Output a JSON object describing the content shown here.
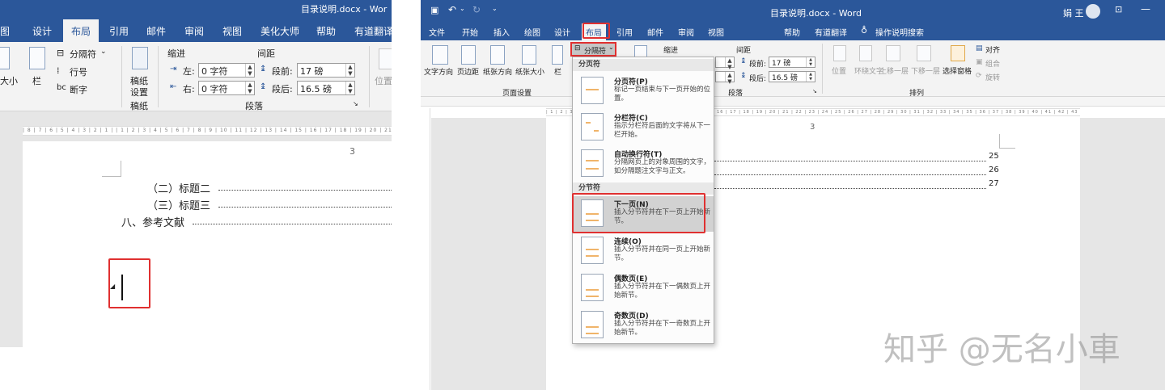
{
  "left": {
    "title": "目录说明.docx - Wor",
    "tabs": [
      "图",
      "设计",
      "布局",
      "引用",
      "邮件",
      "审阅",
      "视图",
      "美化大师",
      "帮助",
      "有道翻译"
    ],
    "ribbon": {
      "size_label": "大小",
      "columns_label": "栏",
      "breaks_label": "分隔符",
      "line_numbers_label": "行号",
      "hyphenation_label": "断字",
      "draft_paper_line1": "稿纸",
      "draft_paper_line2": "设置",
      "draft_paper_group": "稿纸",
      "indent_header": "缩进",
      "spacing_header": "间距",
      "indent_left_label": "左:",
      "indent_left_value": "0 字符",
      "indent_right_label": "右:",
      "indent_right_value": "0 字符",
      "spacing_before_label": "段前:",
      "spacing_before_value": "17 磅",
      "spacing_after_label": "段后:",
      "spacing_after_value": "16.5 磅",
      "paragraph_group": "段落",
      "position_label": "位置"
    },
    "ruler": "| 8 | 7 | 6 | 5 | 4 | 3 | 2 | 1 |  | 1 | 2 | 3 | 4 | 5 | 6 | 7 | 8 | 9 | 10 | 11 | 12 | 13 | 14 | 15 | 16 | 17 | 18 | 19 | 20 | 21 | 22",
    "page_number": "3",
    "toc": [
      "（二）标题二",
      "（三）标题三",
      "八、参考文献"
    ]
  },
  "right": {
    "title": "目录说明.docx - Word",
    "user": "娟 王",
    "tabs": [
      "文件",
      "开始",
      "插入",
      "绘图",
      "设计",
      "布局",
      "引用",
      "邮件",
      "审阅",
      "视图",
      "帮助",
      "有道翻译"
    ],
    "tell_me": "操作说明搜索",
    "ribbon": {
      "text_direction": "文字方向",
      "margins": "页边距",
      "orientation": "纸张方向",
      "size": "纸张大小",
      "columns": "栏",
      "breaks": "分隔符",
      "page_setup_group": "页面设置",
      "indent_header": "缩进",
      "spacing_header": "间距",
      "spacing_before_label": "段前:",
      "spacing_before_value": "17 磅",
      "spacing_after_label": "段后:",
      "spacing_after_value": "16.5 磅",
      "paragraph_group": "段落",
      "position": "位置",
      "wrap_text": "环绕文字",
      "bring_forward": "上移一层",
      "send_backward": "下移一层",
      "selection_pane": "选择窗格",
      "align": "对齐",
      "group": "组合",
      "rotate": "旋转",
      "arrange_group": "排列"
    },
    "ruler": "| 1 | 2 | 3 | 4 | 5 | 6 | 7 | 8 | 9 | 10 | 11 | 12 | 13 | 14 | 15 | 16 | 17 | 18 | 19 | 20 | 21 | 22 | 23 | 24 | 25 | 26 | 27 | 28 | 29 | 30 | 31 | 32 | 33 | 34 | 35 | 36 | 37 | 38 | 39 | 40 | 41 | 42 | 43 | 44 | 45 | 46 | 47 | 48",
    "page_number": "3",
    "toc_pages": [
      "25",
      "26",
      "27"
    ],
    "menu": {
      "section_page": "分页符",
      "section_section": "分节符",
      "items": [
        {
          "title": "分页符(P)",
          "desc": "标记一页结束与下一页开始的位置。"
        },
        {
          "title": "分栏符(C)",
          "desc": "指示分栏符后面的文字将从下一栏开始。"
        },
        {
          "title": "自动换行符(T)",
          "desc": "分隔网页上的对象周围的文字，如分隔题注文字与正文。"
        },
        {
          "title": "下一页(N)",
          "desc": "插入分节符并在下一页上开始新节。"
        },
        {
          "title": "连续(O)",
          "desc": "插入分节符并在同一页上开始新节。"
        },
        {
          "title": "偶数页(E)",
          "desc": "插入分节符并在下一偶数页上开始新节。"
        },
        {
          "title": "奇数页(D)",
          "desc": "插入分节符并在下一奇数页上开始新节。"
        }
      ]
    }
  },
  "watermark": "知乎 @无名小車"
}
